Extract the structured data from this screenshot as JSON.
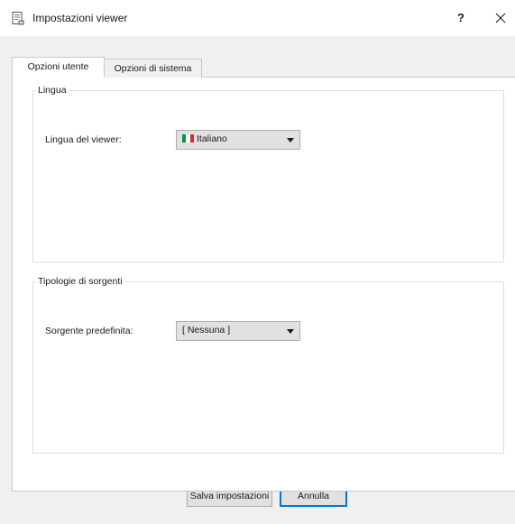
{
  "window": {
    "title": "Impostazioni viewer",
    "help_label": "?",
    "icon": "settings-document-icon",
    "close_icon": "close-icon"
  },
  "tabs": [
    {
      "label": "Opzioni utente",
      "active": true
    },
    {
      "label": "Opzioni di sistema",
      "active": false
    }
  ],
  "groups": {
    "language": {
      "title": "Lingua",
      "field_label": "Lingua del viewer:",
      "selected": "Italiano",
      "flag_icon": "italian-flag-icon",
      "flag_colors": [
        "#009246",
        "#ffffff",
        "#ce2b37"
      ]
    },
    "sources": {
      "title": "Tipologie di sorgenti",
      "field_label": "Sorgente predefinita:",
      "selected": "[ Nessuna ]"
    }
  },
  "buttons": {
    "save": "Salva impostazioni",
    "cancel": "Annulla"
  },
  "colors": {
    "focus_border": "#0078d7",
    "dialog_background": "#f0f0f0"
  }
}
